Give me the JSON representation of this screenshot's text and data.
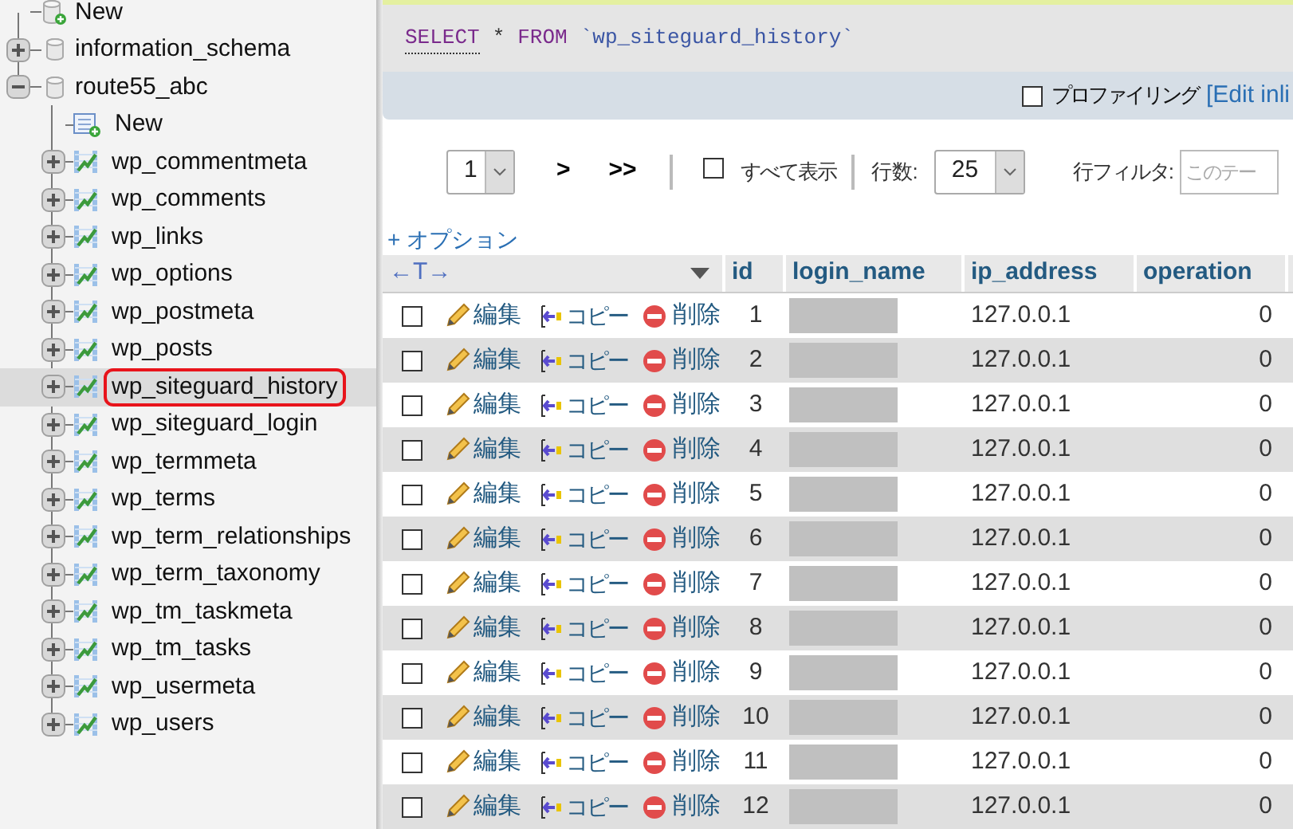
{
  "navigation": [
    {
      "kind": "new",
      "name": "New"
    },
    {
      "kind": "database",
      "name": "information_schema",
      "expanded": false
    },
    {
      "kind": "database",
      "name": "route55_abc",
      "expanded": true,
      "children": [
        {
          "kind": "new",
          "name": "New"
        },
        {
          "kind": "table",
          "name": "wp_commentmeta",
          "selected": false
        },
        {
          "kind": "table",
          "name": "wp_comments",
          "selected": false
        },
        {
          "kind": "table",
          "name": "wp_links",
          "selected": false
        },
        {
          "kind": "table",
          "name": "wp_options",
          "selected": false
        },
        {
          "kind": "table",
          "name": "wp_postmeta",
          "selected": false
        },
        {
          "kind": "table",
          "name": "wp_posts",
          "selected": false
        },
        {
          "kind": "table",
          "name": "wp_siteguard_history",
          "selected": true
        },
        {
          "kind": "table",
          "name": "wp_siteguard_login",
          "selected": false
        },
        {
          "kind": "table",
          "name": "wp_termmeta",
          "selected": false
        },
        {
          "kind": "table",
          "name": "wp_terms",
          "selected": false
        },
        {
          "kind": "table",
          "name": "wp_term_relationships",
          "selected": false
        },
        {
          "kind": "table",
          "name": "wp_term_taxonomy",
          "selected": false
        },
        {
          "kind": "table",
          "name": "wp_tm_taskmeta",
          "selected": false
        },
        {
          "kind": "table",
          "name": "wp_tm_tasks",
          "selected": false
        },
        {
          "kind": "table",
          "name": "wp_usermeta",
          "selected": false
        },
        {
          "kind": "table",
          "name": "wp_users",
          "selected": false
        }
      ]
    }
  ],
  "query": {
    "tokens": [
      {
        "kind": "keyword",
        "text": "SELECT"
      },
      {
        "kind": "operator",
        "text": "*"
      },
      {
        "kind": "keyword",
        "text": "FROM"
      },
      {
        "kind": "identifier",
        "text": "`wp_siteguard_history`"
      }
    ],
    "profiling": {
      "label": "プロファイリング",
      "checked": false
    },
    "edit_link": "[Edit inli"
  },
  "pagination": {
    "page": "1",
    "next": ">",
    "last": ">>",
    "show_all": {
      "label": "すべて表示",
      "checked": false
    },
    "rows_label": "行数:",
    "rows": "25",
    "filter_label": "行フィルタ:",
    "filter_placeholder": "このテー"
  },
  "options_link": "+ オプション",
  "table": {
    "columns_toggle": "←T→",
    "columns": [
      "id",
      "login_name",
      "ip_address",
      "operation"
    ],
    "rows": [
      {
        "edit": "編集",
        "copy": "コピー",
        "delete": "削除",
        "id": "1",
        "ip_address": "127.0.0.1",
        "operation": "0",
        "checked": false
      },
      {
        "edit": "編集",
        "copy": "コピー",
        "delete": "削除",
        "id": "2",
        "ip_address": "127.0.0.1",
        "operation": "0",
        "checked": false
      },
      {
        "edit": "編集",
        "copy": "コピー",
        "delete": "削除",
        "id": "3",
        "ip_address": "127.0.0.1",
        "operation": "0",
        "checked": false
      },
      {
        "edit": "編集",
        "copy": "コピー",
        "delete": "削除",
        "id": "4",
        "ip_address": "127.0.0.1",
        "operation": "0",
        "checked": false
      },
      {
        "edit": "編集",
        "copy": "コピー",
        "delete": "削除",
        "id": "5",
        "ip_address": "127.0.0.1",
        "operation": "0",
        "checked": false
      },
      {
        "edit": "編集",
        "copy": "コピー",
        "delete": "削除",
        "id": "6",
        "ip_address": "127.0.0.1",
        "operation": "0",
        "checked": false
      },
      {
        "edit": "編集",
        "copy": "コピー",
        "delete": "削除",
        "id": "7",
        "ip_address": "127.0.0.1",
        "operation": "0",
        "checked": false
      },
      {
        "edit": "編集",
        "copy": "コピー",
        "delete": "削除",
        "id": "8",
        "ip_address": "127.0.0.1",
        "operation": "0",
        "checked": false
      },
      {
        "edit": "編集",
        "copy": "コピー",
        "delete": "削除",
        "id": "9",
        "ip_address": "127.0.0.1",
        "operation": "0",
        "checked": false
      },
      {
        "edit": "編集",
        "copy": "コピー",
        "delete": "削除",
        "id": "10",
        "ip_address": "127.0.0.1",
        "operation": "0",
        "checked": false
      },
      {
        "edit": "編集",
        "copy": "コピー",
        "delete": "削除",
        "id": "11",
        "ip_address": "127.0.0.1",
        "operation": "0",
        "checked": false
      },
      {
        "edit": "編集",
        "copy": "コピー",
        "delete": "削除",
        "id": "12",
        "ip_address": "127.0.0.1",
        "operation": "0",
        "checked": false
      }
    ]
  }
}
